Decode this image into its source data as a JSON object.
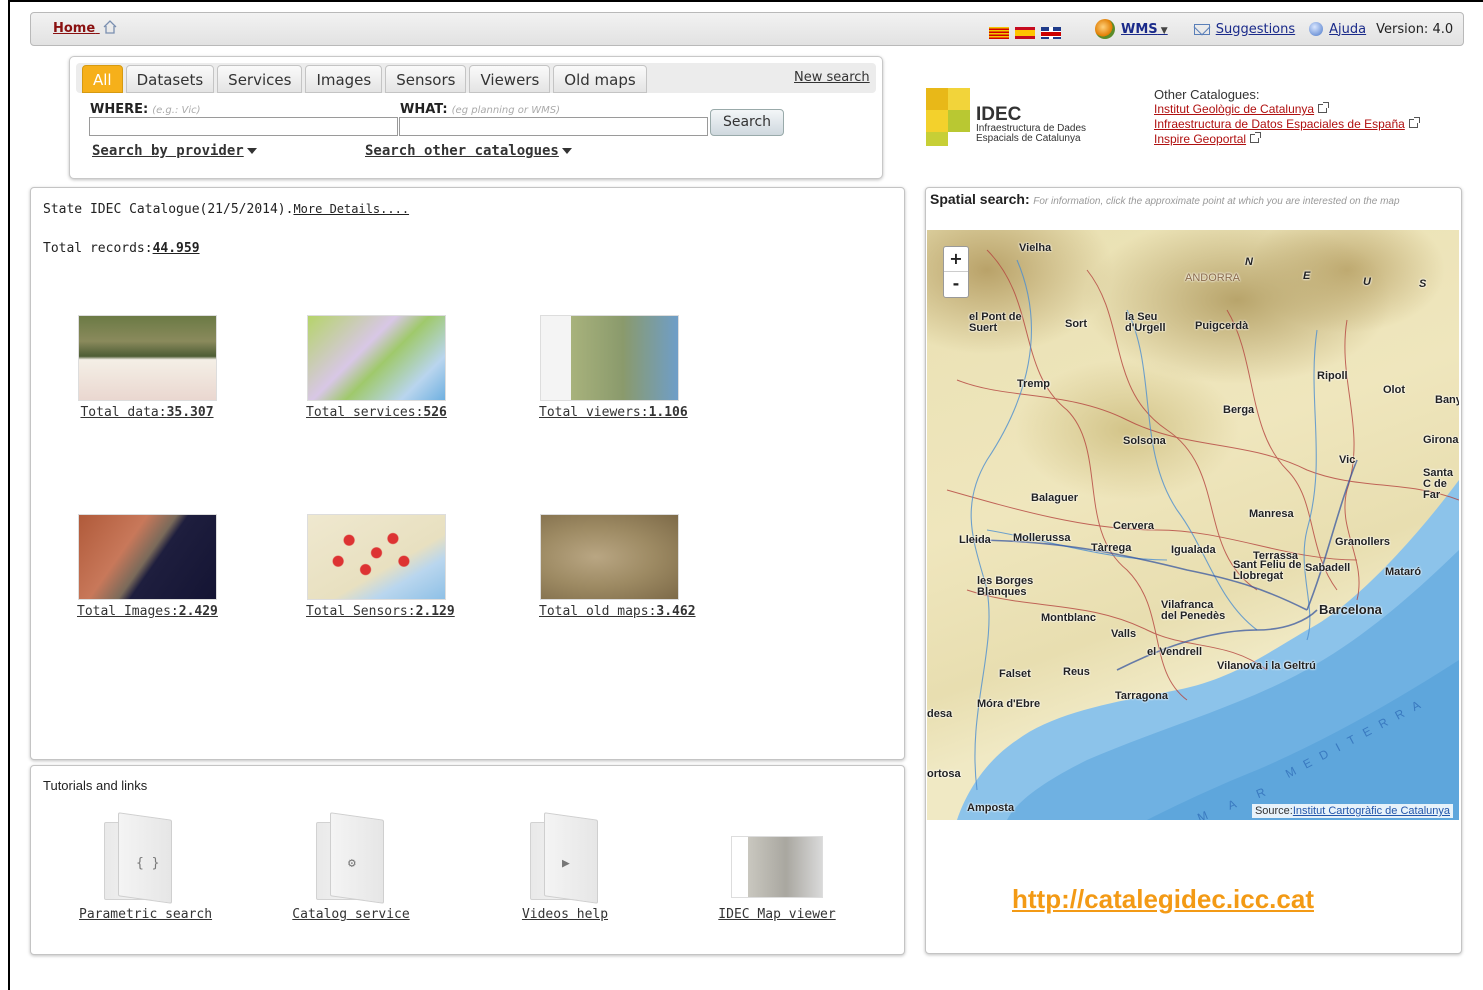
{
  "topbar": {
    "home": "Home",
    "wms": "WMS",
    "suggestions": "Suggestions",
    "help": "Ajuda",
    "version": "Version: 4.0"
  },
  "search": {
    "tabs": [
      "All",
      "Datasets",
      "Services",
      "Images",
      "Sensors",
      "Viewers",
      "Old maps"
    ],
    "active_tab": "All",
    "new_search": "New search",
    "where_label": "WHERE:",
    "where_placeholder": "(e.g.: Vic)",
    "what_label": "WHAT:",
    "what_placeholder": "(eg planning or WMS)",
    "search_button": "Search",
    "by_provider": "Search by provider",
    "other_catalogues": "Search other catalogues"
  },
  "logo": {
    "title": "IDEC",
    "subtitle_line1": "Infraestructura de Dades",
    "subtitle_line2": "Espacials de Catalunya"
  },
  "other_catalogues": {
    "heading": "Other Catalogues:",
    "links": [
      "Institut Geològic de Catalunya",
      "Infraestructura de Datos Espaciales de España",
      "Inspire Geoportal"
    ]
  },
  "catalog": {
    "state_text": "State IDEC Catalogue(21/5/2014).",
    "more_details": "More Details....",
    "total_records_label": "Total records:",
    "total_records_value": "44.959",
    "tiles": [
      {
        "label": "Total data:",
        "value": "35.307"
      },
      {
        "label": "Total services:",
        "value": "526"
      },
      {
        "label": "Total viewers:",
        "value": "1.106"
      },
      {
        "label": "Total Images:",
        "value": "2.429"
      },
      {
        "label": "Total Sensors:",
        "value": "2.129"
      },
      {
        "label": "Total old maps:",
        "value": "3.462"
      }
    ]
  },
  "tutorials": {
    "heading": "Tutorials and links",
    "items": [
      "Parametric search",
      "Catalog service",
      "Videos help",
      "IDEC Map viewer"
    ]
  },
  "spatial": {
    "title": "Spatial search:",
    "hint": "For information, click the approximate point at which you are interested on the map",
    "zoom_in": "+",
    "zoom_out": "-",
    "source_label": "Source:",
    "source_link": "Institut Cartogràfic de Catalunya",
    "towns": [
      "Vielha",
      "ANDORRA",
      "el Pont de Suert",
      "Sort",
      "la Seu d'Urgell",
      "Puigcerdà",
      "Tremp",
      "Ripoll",
      "Olot",
      "Bany",
      "Berga",
      "Solsona",
      "Girona",
      "Vic",
      "Santa C de Far",
      "Balaguer",
      "Manresa",
      "Cervera",
      "Granollers",
      "Lleida",
      "Mollerussa",
      "Tàrrega",
      "Igualada",
      "Terrassa",
      "Sabadell",
      "Mataró",
      "les Borges Blanques",
      "Sant Feliu de Llobregat",
      "Barcelona",
      "Montblanc",
      "Vilafranca del Penedès",
      "Valls",
      "el Vendrell",
      "Falset",
      "Reus",
      "Vilanova i la Geltrú",
      "Tarragona",
      "Móra d'Ebre",
      "desa",
      "ortosa",
      "Amposta"
    ],
    "compass": [
      "N",
      "E",
      "U",
      "S"
    ],
    "sea_label": "MEDITERRA",
    "sea_label2": "M A R"
  },
  "footer_url": "http://catalegidec.icc.cat"
}
